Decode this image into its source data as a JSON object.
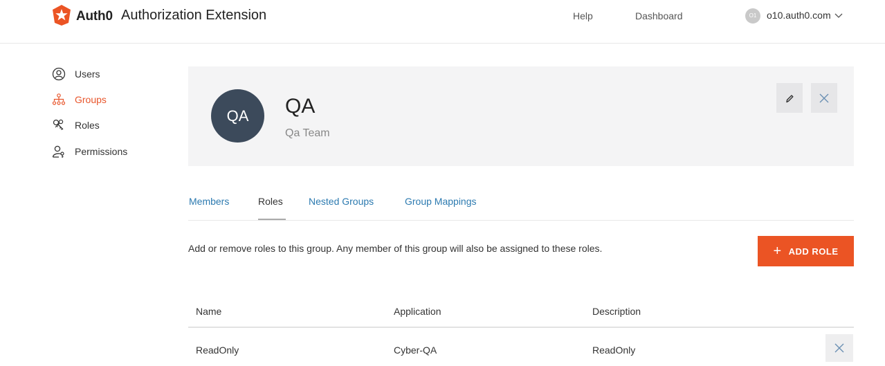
{
  "header": {
    "brand": "Auth0",
    "app_title": "Authorization Extension",
    "nav": {
      "help": "Help",
      "dashboard": "Dashboard"
    },
    "tenant": {
      "avatar_initials": "O1",
      "name": "o10.auth0.com"
    }
  },
  "sidebar": {
    "items": [
      {
        "label": "Users",
        "icon": "user-circle-icon",
        "active": false
      },
      {
        "label": "Groups",
        "icon": "hierarchy-icon",
        "active": true
      },
      {
        "label": "Roles",
        "icon": "keys-icon",
        "active": false
      },
      {
        "label": "Permissions",
        "icon": "user-key-icon",
        "active": false
      }
    ]
  },
  "group": {
    "avatar_initials": "QA",
    "name": "QA",
    "description": "Qa Team"
  },
  "tabs": [
    {
      "label": "Members",
      "active": false
    },
    {
      "label": "Roles",
      "active": true
    },
    {
      "label": "Nested Groups",
      "active": false
    },
    {
      "label": "Group Mappings",
      "active": false
    }
  ],
  "roles_section": {
    "description": "Add or remove roles to this group. Any member of this group will also be assigned to these roles.",
    "add_button": "ADD ROLE"
  },
  "table": {
    "columns": [
      "Name",
      "Application",
      "Description"
    ],
    "rows": [
      {
        "name": "ReadOnly",
        "application": "Cyber-QA",
        "description": "ReadOnly"
      }
    ]
  },
  "colors": {
    "accent": "#eb5424",
    "link": "#2c7ab0",
    "avatar_bg": "#3c4a5b",
    "card_bg": "#f4f4f5"
  }
}
